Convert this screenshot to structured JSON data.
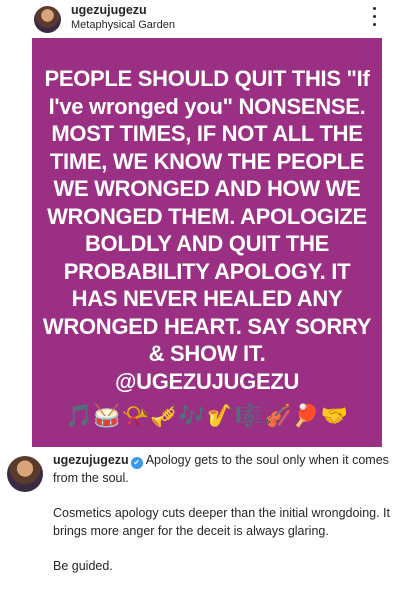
{
  "post_header": {
    "username": "ugezujugezu",
    "location": "Metaphysical Garden",
    "more_icon": "three-vertical-dots-icon"
  },
  "post_image": {
    "background": "#9b2f84",
    "text": "PEOPLE SHOULD QUIT THIS \"If\nI've wronged you\" NONSENSE.\nMOST TIMES, IF NOT ALL THE\nTIME, WE KNOW THE PEOPLE\nWE WRONGED AND HOW WE\nWRONGED THEM. APOLOGIZE\nBOLDLY AND QUIT THE\nPROBABILITY APOLOGY. IT\nHAS NEVER HEALED ANY\nWRONGED HEART. SAY SORRY\n& SHOW IT.\n@UGEZUJUGEZU",
    "emojis": "🎵🥁📯🎺🎶🎷🎼🎻🏓🤝"
  },
  "caption": {
    "username": "ugezujugezu",
    "verified_icon": "verified-badge-icon",
    "first_line": "Apology gets to the soul only when it comes from the soul.",
    "paragraph_2": "Cosmetics apology cuts deeper than the initial wrongdoing. It brings more anger for the deceit is always glaring.",
    "paragraph_3": "Be guided."
  }
}
